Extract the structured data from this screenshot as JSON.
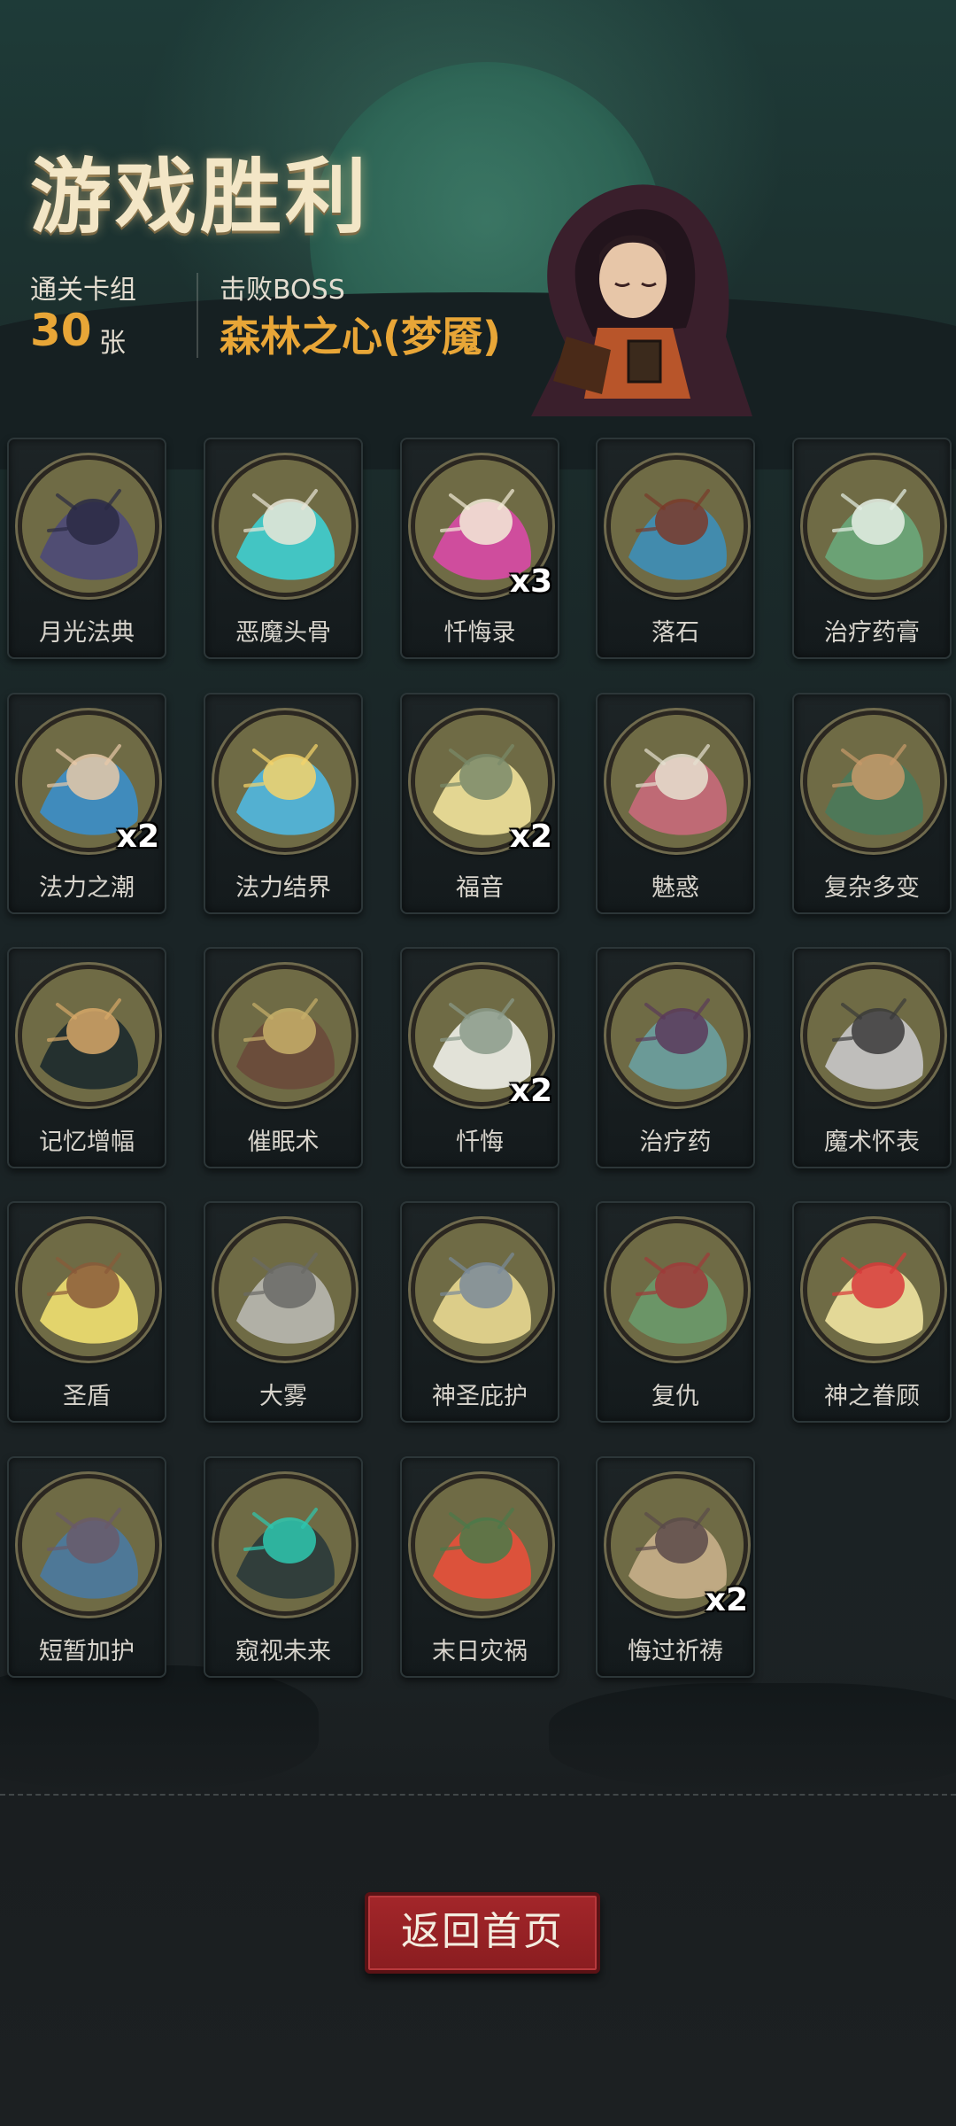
{
  "header": {
    "title": "游戏胜利",
    "deck_label": "通关卡组",
    "deck_count": "30",
    "deck_unit": "张",
    "boss_label": "击败BOSS",
    "boss_name": "森林之心(梦魇)"
  },
  "cards": [
    {
      "name": "月光法典",
      "qty": "",
      "icon": "moonlight-tome-icon",
      "color": "#6f6b45"
    },
    {
      "name": "恶魔头骨",
      "qty": "",
      "icon": "demon-skull-icon",
      "color": "#6f6b45"
    },
    {
      "name": "忏悔录",
      "qty": "x3",
      "icon": "confession-book-icon",
      "color": "#6f6b45"
    },
    {
      "name": "落石",
      "qty": "",
      "icon": "falling-rock-icon",
      "color": "#6f6b45"
    },
    {
      "name": "治疗药膏",
      "qty": "",
      "icon": "healing-ointment-icon",
      "color": "#6f6b45"
    },
    {
      "name": "法力之潮",
      "qty": "x2",
      "icon": "mana-tide-icon",
      "color": "#6f6b45"
    },
    {
      "name": "法力结界",
      "qty": "",
      "icon": "mana-barrier-icon",
      "color": "#6f6b45"
    },
    {
      "name": "福音",
      "qty": "x2",
      "icon": "gospel-icon",
      "color": "#6f6b45"
    },
    {
      "name": "魅惑",
      "qty": "",
      "icon": "charm-icon",
      "color": "#6f6b45"
    },
    {
      "name": "复杂多变",
      "qty": "",
      "icon": "complex-change-icon",
      "color": "#6f6b45"
    },
    {
      "name": "记忆增幅",
      "qty": "",
      "icon": "memory-boost-icon",
      "color": "#6f6b45"
    },
    {
      "name": "催眠术",
      "qty": "",
      "icon": "hypnosis-icon",
      "color": "#6f6b45"
    },
    {
      "name": "忏悔",
      "qty": "x2",
      "icon": "repentance-icon",
      "color": "#6f6b45"
    },
    {
      "name": "治疗药",
      "qty": "",
      "icon": "healing-potion-icon",
      "color": "#6f6b45"
    },
    {
      "name": "魔术怀表",
      "qty": "",
      "icon": "magic-pocket-watch-icon",
      "color": "#6f6b45"
    },
    {
      "name": "圣盾",
      "qty": "",
      "icon": "holy-shield-icon",
      "color": "#6f6b45"
    },
    {
      "name": "大雾",
      "qty": "",
      "icon": "heavy-fog-icon",
      "color": "#6f6b45"
    },
    {
      "name": "神圣庇护",
      "qty": "",
      "icon": "divine-protection-icon",
      "color": "#6f6b45"
    },
    {
      "name": "复仇",
      "qty": "",
      "icon": "revenge-icon",
      "color": "#6f6b45"
    },
    {
      "name": "神之眷顾",
      "qty": "",
      "icon": "divine-favor-icon",
      "color": "#6f6b45"
    },
    {
      "name": "短暂加护",
      "qty": "",
      "icon": "brief-blessing-icon",
      "color": "#6f6b45"
    },
    {
      "name": "窥视未来",
      "qty": "",
      "icon": "peek-future-icon",
      "color": "#6f6b45"
    },
    {
      "name": "末日灾祸",
      "qty": "",
      "icon": "doomsday-icon",
      "color": "#6f6b45"
    },
    {
      "name": "悔过祈祷",
      "qty": "x2",
      "icon": "penitent-prayer-icon",
      "color": "#6f6b45"
    }
  ],
  "footer": {
    "home_button": "返回首页"
  },
  "colors": {
    "accent_gold": "#e8a637",
    "button_red": "#a3262a",
    "card_art_bg": "#6f6b45"
  }
}
